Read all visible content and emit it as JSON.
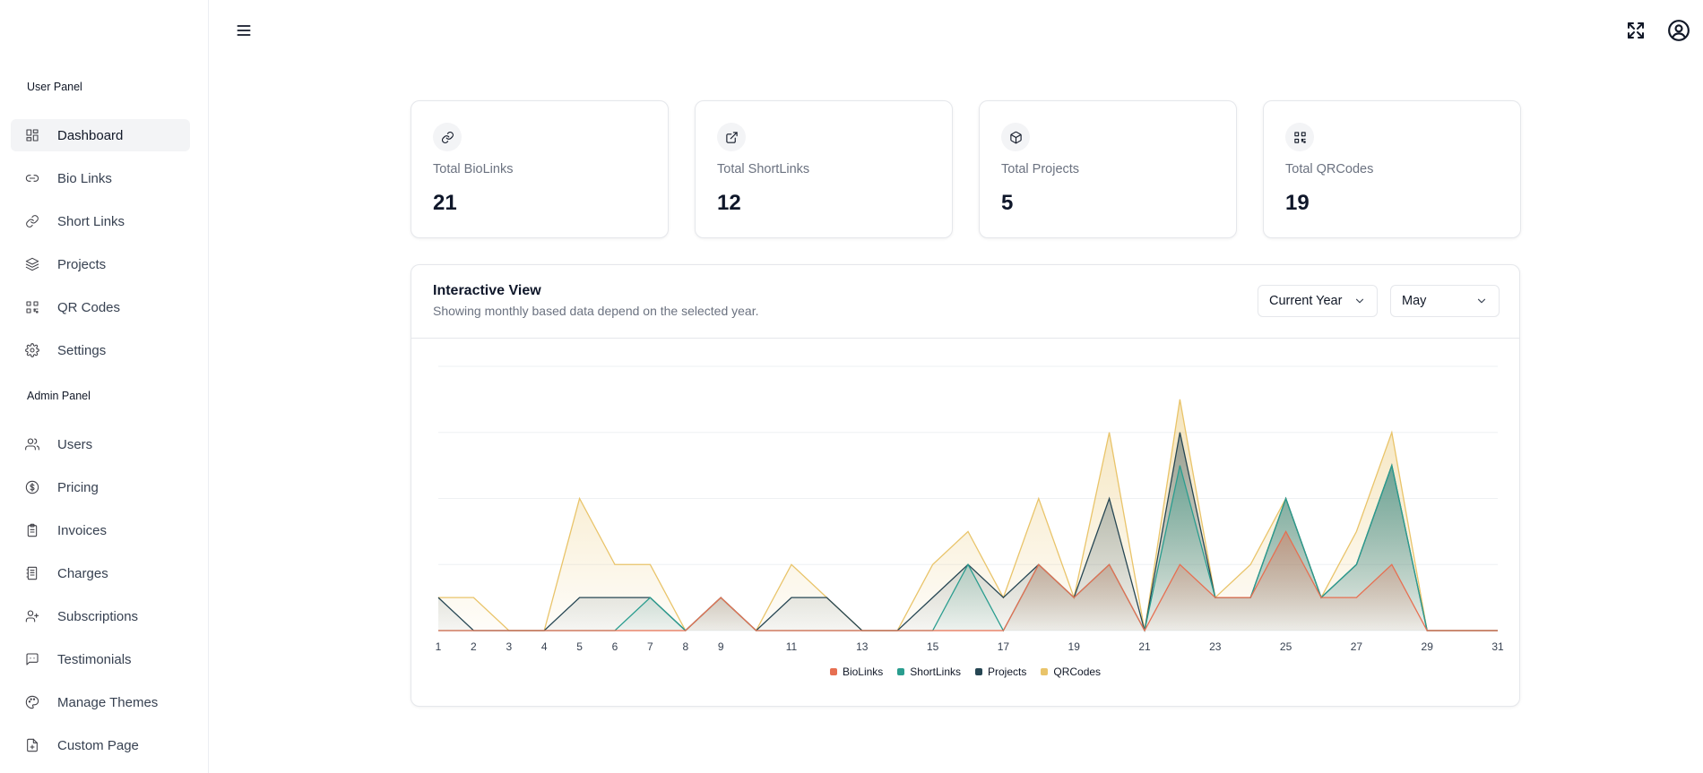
{
  "sidebar": {
    "user_panel_label": "User Panel",
    "admin_panel_label": "Admin Panel",
    "user_items": [
      {
        "label": "Dashboard",
        "icon": "dashboard-icon",
        "active": true
      },
      {
        "label": "Bio Links",
        "icon": "link-icon"
      },
      {
        "label": "Short Links",
        "icon": "chain-link-icon"
      },
      {
        "label": "Projects",
        "icon": "layers-icon"
      },
      {
        "label": "QR Codes",
        "icon": "qr-code-icon"
      },
      {
        "label": "Settings",
        "icon": "gear-icon"
      }
    ],
    "admin_items": [
      {
        "label": "Users",
        "icon": "users-icon"
      },
      {
        "label": "Pricing",
        "icon": "dollar-circle-icon"
      },
      {
        "label": "Invoices",
        "icon": "clipboard-icon"
      },
      {
        "label": "Charges",
        "icon": "receipt-icon"
      },
      {
        "label": "Subscriptions",
        "icon": "user-plus-icon"
      },
      {
        "label": "Testimonials",
        "icon": "message-square-icon"
      },
      {
        "label": "Manage Themes",
        "icon": "palette-icon"
      },
      {
        "label": "Custom Page",
        "icon": "file-plus-icon"
      }
    ]
  },
  "header": {
    "menu_icon": "hamburger-menu-icon",
    "fullscreen_icon": "fullscreen-icon",
    "profile_icon": "user-circle-icon"
  },
  "stats": [
    {
      "title": "Total BioLinks",
      "value": "21",
      "icon": "link-icon"
    },
    {
      "title": "Total ShortLinks",
      "value": "12",
      "icon": "external-link-icon"
    },
    {
      "title": "Total Projects",
      "value": "5",
      "icon": "box-icon"
    },
    {
      "title": "Total QRCodes",
      "value": "19",
      "icon": "qr-code-icon"
    }
  ],
  "panel": {
    "title": "Interactive View",
    "subtitle": "Showing monthly based data depend on the selected year.",
    "year_select": "Current Year",
    "month_select": "May"
  },
  "chart_data": {
    "type": "area",
    "x": [
      1,
      2,
      3,
      4,
      5,
      6,
      7,
      8,
      9,
      10,
      11,
      12,
      13,
      14,
      15,
      16,
      17,
      18,
      19,
      20,
      21,
      22,
      23,
      24,
      25,
      26,
      27,
      28,
      29,
      30,
      31
    ],
    "x_tick_labels": [
      "1",
      "2",
      "3",
      "4",
      "5",
      "6",
      "7",
      "8",
      "9",
      "11",
      "13",
      "15",
      "17",
      "19",
      "21",
      "23",
      "25",
      "27",
      "29",
      "31"
    ],
    "stacked": true,
    "ylim": [
      0,
      8
    ],
    "grid": true,
    "legend": "bottom-center",
    "series": [
      {
        "name": "BioLinks",
        "color": "#e76f51",
        "values": [
          0,
          0,
          0,
          0,
          0,
          0,
          0,
          0,
          1,
          0,
          0,
          0,
          0,
          0,
          0,
          0,
          0,
          2,
          1,
          2,
          0,
          2,
          1,
          1,
          3,
          1,
          1,
          2,
          0,
          0,
          0
        ]
      },
      {
        "name": "ShortLinks",
        "color": "#2a9d8f",
        "values": [
          0,
          0,
          0,
          0,
          0,
          0,
          1,
          0,
          0,
          0,
          0,
          0,
          0,
          0,
          0,
          2,
          0,
          0,
          0,
          0,
          0,
          3,
          0,
          0,
          1,
          0,
          1,
          3,
          0,
          0,
          0
        ]
      },
      {
        "name": "Projects",
        "color": "#264653",
        "values": [
          1,
          0,
          0,
          0,
          1,
          1,
          0,
          0,
          0,
          0,
          1,
          1,
          0,
          0,
          1,
          0,
          1,
          0,
          0,
          2,
          0,
          1,
          0,
          0,
          0,
          0,
          0,
          0,
          0,
          0,
          0
        ]
      },
      {
        "name": "QRCodes",
        "color": "#e9c46a",
        "values": [
          0,
          1,
          0,
          0,
          3,
          1,
          1,
          0,
          0,
          0,
          1,
          0,
          0,
          0,
          1,
          1,
          0,
          2,
          0,
          2,
          0,
          1,
          0,
          1,
          0,
          0,
          1,
          1,
          0,
          0,
          0
        ]
      }
    ]
  }
}
